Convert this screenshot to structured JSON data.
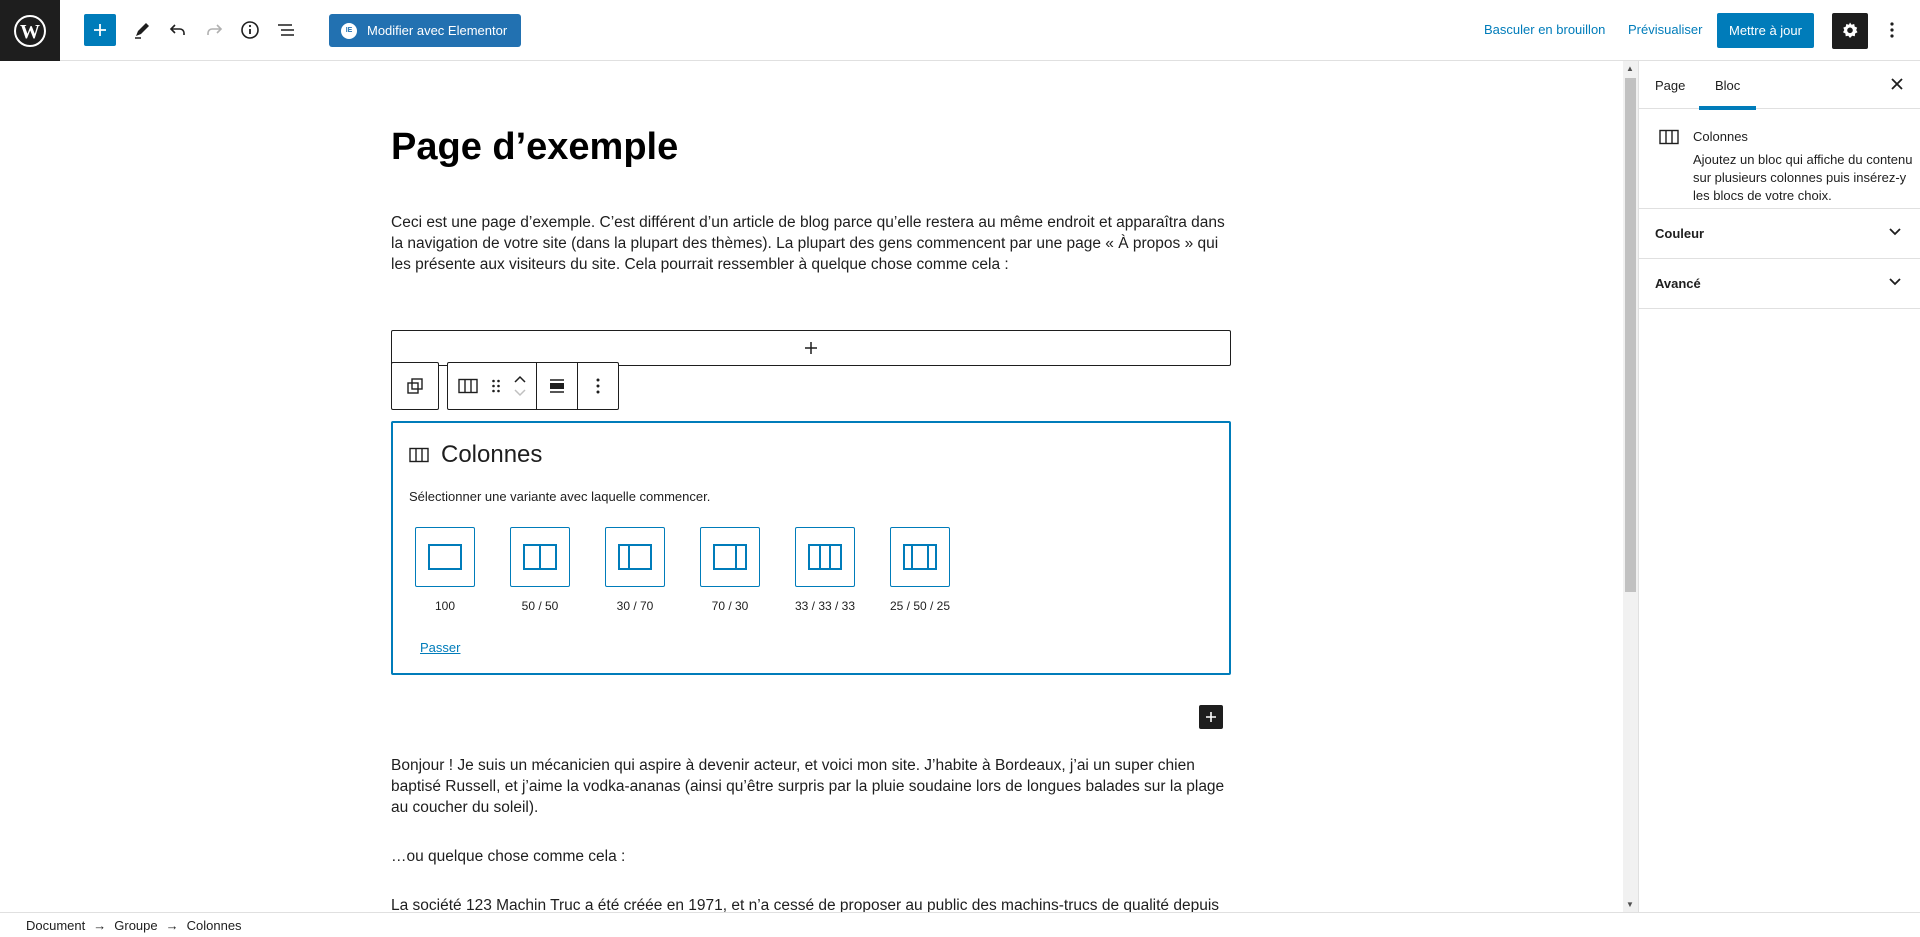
{
  "header": {
    "update_label": "Mettre à jour",
    "preview_label": "Prévisualiser",
    "draft_label": "Basculer en brouillon",
    "elementor_label": "Modifier avec Elementor",
    "elementor_icon_text": "IE"
  },
  "editor": {
    "title": "Page d’exemple",
    "paragraphs": [
      "Ceci est une page d’exemple. C’est différent d’un article de blog parce qu’elle restera au même endroit et apparaîtra dans la navigation de votre site (dans la plupart des thèmes). La plupart des gens commencent par une page « À propos » qui les présente aux visiteurs du site. Cela pourrait ressembler à quelque chose comme cela :",
      "Bonjour ! Je suis un mécanicien qui aspire à devenir acteur, et voici mon site. J’habite à Bordeaux, j’ai un super chien baptisé Russell, et j’aime la vodka-ananas (ainsi qu’être surpris par la pluie soudaine lors de longues balades sur la plage au coucher du soleil).",
      "…ou quelque chose comme cela :",
      "La société 123 Machin Truc a été créée en 1971, et n’a cessé de proposer au public des machins-trucs de qualité depuis"
    ]
  },
  "columns_placeholder": {
    "title": "Colonnes",
    "instructions": "Sélectionner une variante avec laquelle commencer.",
    "skip_label": "Passer",
    "variations": [
      {
        "label": "100"
      },
      {
        "label": "50 / 50"
      },
      {
        "label": "30 / 70"
      },
      {
        "label": "70 / 30"
      },
      {
        "label": "33 / 33 / 33"
      },
      {
        "label": "25 / 50 / 25"
      }
    ]
  },
  "sidebar": {
    "tabs": [
      "Page",
      "Bloc"
    ],
    "active_tab": "Bloc",
    "block_name": "Colonnes",
    "block_description": "Ajoutez un bloc qui affiche du contenu sur plusieurs colonnes puis insérez-y les blocs de votre choix.",
    "panels": [
      "Couleur",
      "Avancé"
    ]
  },
  "breadcrumb": [
    "Document",
    "Groupe",
    "Colonnes"
  ],
  "colors": {
    "accent": "#007cba",
    "dark": "#1e1e1e",
    "elementor": "#2271b1"
  }
}
